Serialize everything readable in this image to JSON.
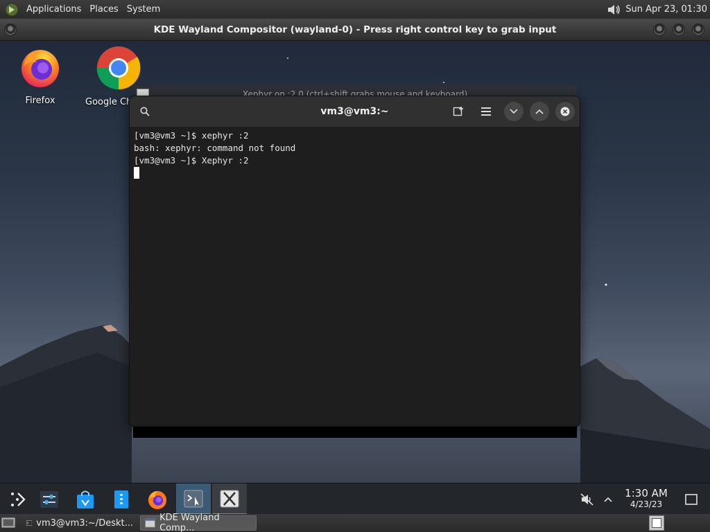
{
  "top_panel": {
    "menus": [
      "Applications",
      "Places",
      "System"
    ],
    "datetime": "Sun Apr 23, 01:30"
  },
  "compositor": {
    "title": "KDE Wayland Compositor (wayland-0) - Press right control key to grab input"
  },
  "desktop_icons": [
    {
      "label": "Firefox",
      "icon": "firefox-icon"
    },
    {
      "label": "Google Ch",
      "icon": "chrome-icon"
    }
  ],
  "xephyr": {
    "title": "Xephyr on :2.0 (ctrl+shift grabs mouse and keyboard)"
  },
  "terminal": {
    "title": "vm3@vm3:~",
    "lines": [
      "[vm3@vm3 ~]$ xephyr :2",
      "bash: xephyr: command not found",
      "[vm3@vm3 ~]$ Xephyr :2"
    ]
  },
  "kde_panel": {
    "time": "1:30 AM",
    "date": "4/23/23"
  },
  "bottom_panel": {
    "tasks": [
      {
        "label": "vm3@vm3:~/Deskt...",
        "active": false
      },
      {
        "label": "KDE Wayland Comp...",
        "active": true
      }
    ]
  },
  "colors": {
    "terminal_bg": "#1e1e1e",
    "header_bg": "#303030",
    "kde_accent": "#3daee9"
  }
}
